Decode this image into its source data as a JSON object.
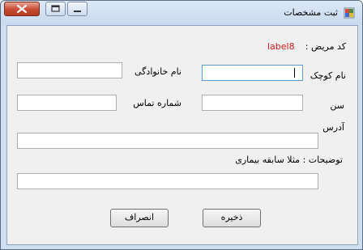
{
  "window": {
    "title": "ثبت مشخصات",
    "icon": "app-icon"
  },
  "titlebar_buttons": {
    "close_icon": "close-icon",
    "maximize_icon": "maximize-icon",
    "minimize_icon": "minimize-icon"
  },
  "form": {
    "patient_code_label": "کد مریض :",
    "patient_code_value": "label8",
    "first_name_label": "نام کوچک",
    "first_name_value": "",
    "last_name_label": "نام خانوادگی",
    "last_name_value": "",
    "age_label": "سن",
    "age_value": "",
    "phone_label": "شماره تماس",
    "phone_value": "",
    "address_label": "آدرس",
    "address_value": "",
    "notes_label": "توضیحات : مثلا سابقه بیماری",
    "notes_value": ""
  },
  "buttons": {
    "save": "ذخیره",
    "cancel": "انصراف"
  },
  "colors": {
    "value_label": "#d11a1a",
    "titlebar": "#cfdff0",
    "client": "#f0f0f0"
  }
}
